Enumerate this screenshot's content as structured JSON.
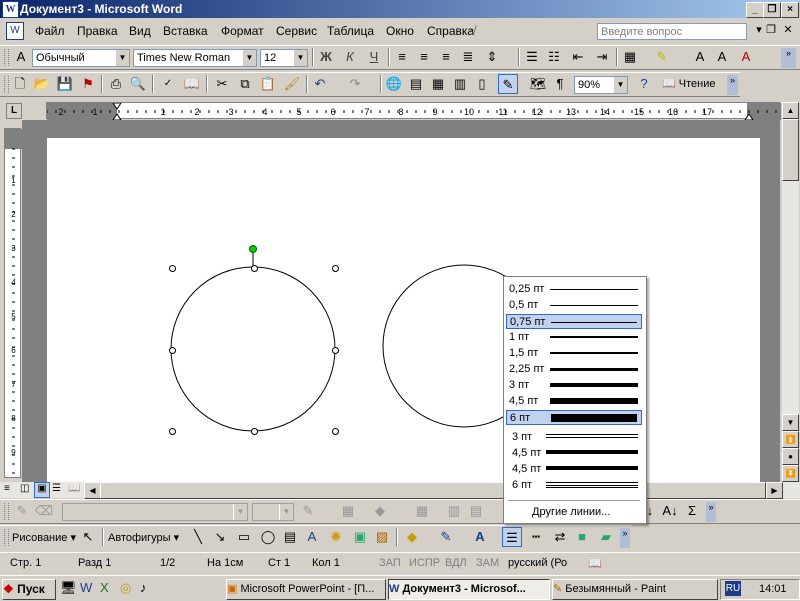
{
  "window": {
    "title": "Документ3 - Microsoft Word",
    "app_icon": "W"
  },
  "menu": {
    "items": [
      "Файл",
      "Правка",
      "Вид",
      "Вставка",
      "Формат",
      "Сервис",
      "Таблица",
      "Окно",
      "Справка"
    ],
    "ask_placeholder": "Введите вопрос"
  },
  "format_toolbar": {
    "style": "Обычный",
    "font": "Times New Roman",
    "size": "12",
    "bold": "Ж",
    "italic": "К",
    "underline": "Ч"
  },
  "standard_toolbar": {
    "zoom": "90%",
    "reading_label": "Чтение"
  },
  "line_weight_menu": {
    "items": [
      {
        "label": "0,25 пт",
        "weight": 0.5,
        "type": "single"
      },
      {
        "label": "0,5 пт",
        "weight": 1,
        "type": "single"
      },
      {
        "label": "0,75 пт",
        "weight": 1,
        "type": "single",
        "selected": true
      },
      {
        "label": "1 пт",
        "weight": 2,
        "type": "single"
      },
      {
        "label": "1,5 пт",
        "weight": 2,
        "type": "single"
      },
      {
        "label": "2,25 пт",
        "weight": 3,
        "type": "single"
      },
      {
        "label": "3 пт",
        "weight": 4,
        "type": "single"
      },
      {
        "label": "4,5 пт",
        "weight": 6,
        "type": "single"
      },
      {
        "label": "6 пт",
        "weight": 8,
        "type": "single",
        "hover": true
      },
      {
        "label": "3 пт",
        "type": "double"
      },
      {
        "label": "4,5 пт",
        "type": "thick-thin"
      },
      {
        "label": "4,5 пт",
        "type": "thin-thick"
      },
      {
        "label": "6 пт",
        "type": "triple"
      }
    ],
    "more_label": "Другие линии..."
  },
  "drawing_toolbar": {
    "draw_label": "Рисование",
    "autoshapes_label": "Автофигуры"
  },
  "status_bar": {
    "page": "Стр. 1",
    "section": "Разд 1",
    "pages": "1/2",
    "at": "На 1см",
    "line": "Ст 1",
    "col": "Кол 1",
    "rec": "ЗАП",
    "trk": "ИСПР",
    "ext": "ВДЛ",
    "ovr": "ЗАМ",
    "language": "русский (Ро"
  },
  "taskbar": {
    "start_label": "Пуск",
    "tasks": [
      "Microsoft PowerPoint - [П...",
      "Документ3 - Microsof...",
      "Безымянный - Paint"
    ],
    "lang": "RU",
    "clock": "14:01"
  },
  "colors": {
    "title_start": "#0a246a",
    "title_end": "#a6caf0",
    "handle_green": "#00cc00",
    "menu_highlight": "#c1d2ee"
  }
}
